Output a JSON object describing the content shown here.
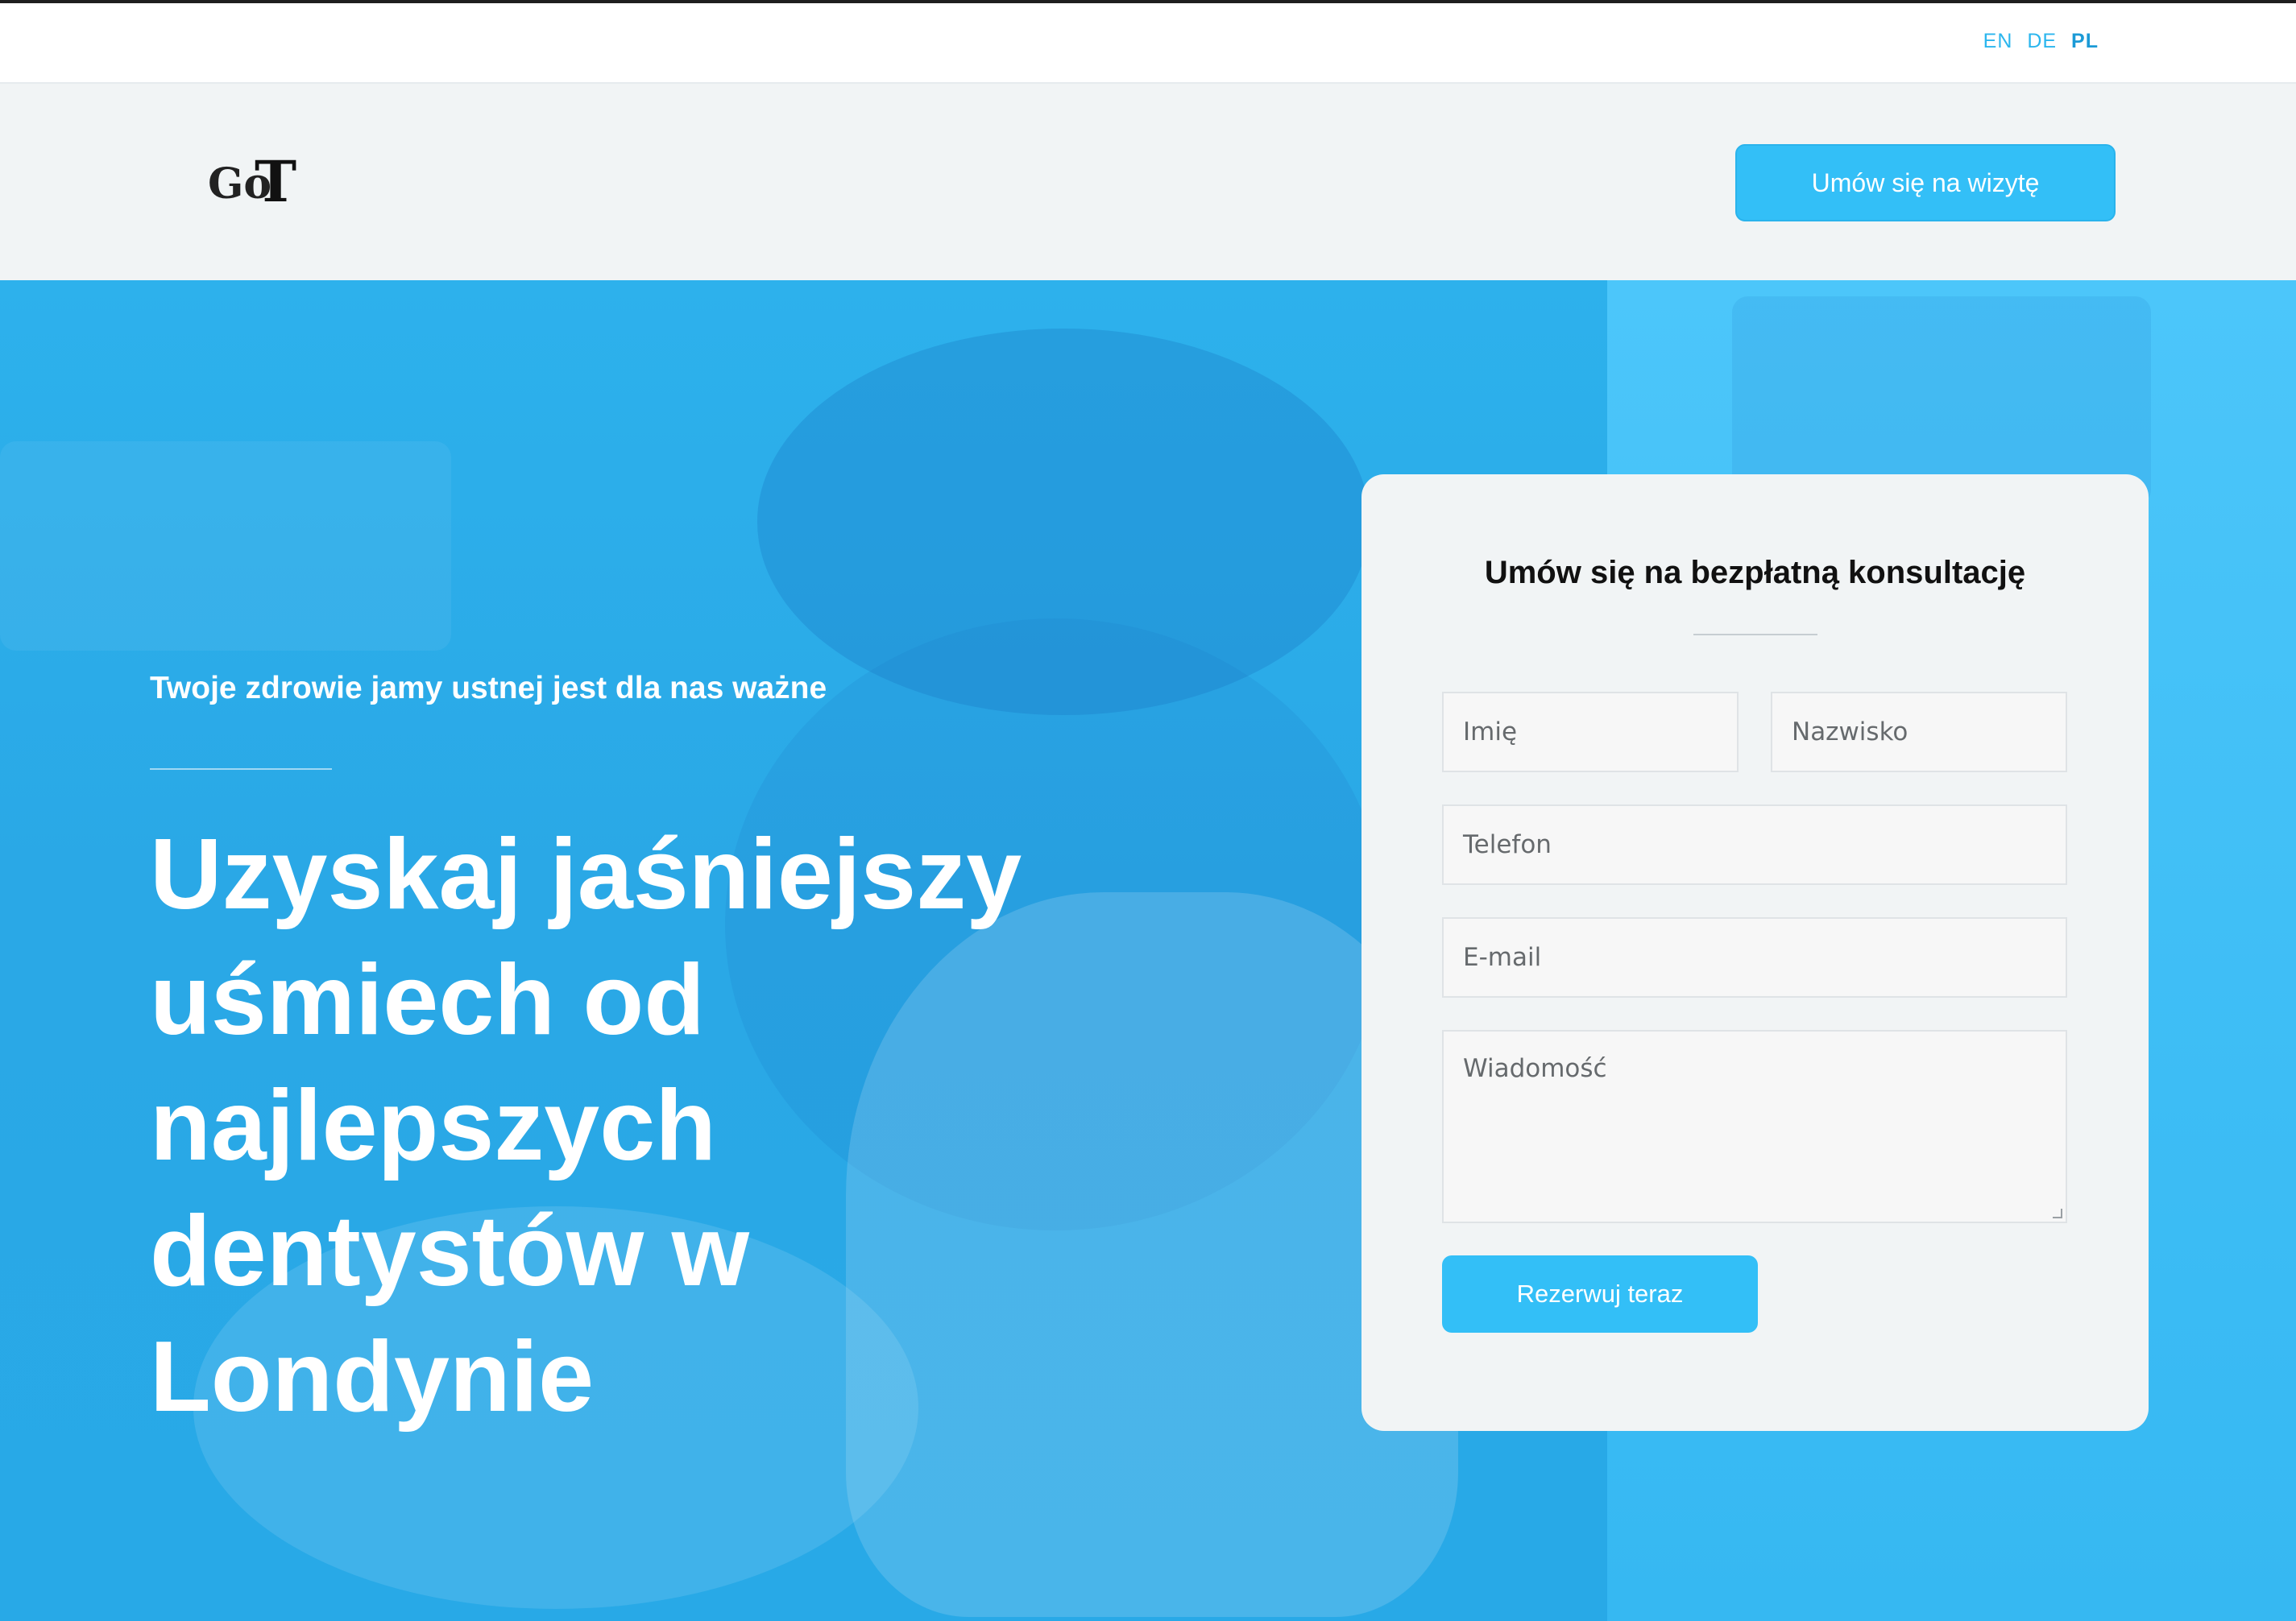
{
  "language_switcher": {
    "options": [
      "EN",
      "DE",
      "PL"
    ],
    "active": "PL"
  },
  "header": {
    "logo_text": "GoT",
    "nav_items": [
      "",
      "",
      "",
      ""
    ],
    "cta_label": "Umów się na wizytę"
  },
  "hero": {
    "kicker": "Twoje zdrowie jamy ustnej jest dla nas ważne",
    "title": "Uzyskaj jaśniejszy uśmiech od najlepszych dentystów w Londynie"
  },
  "form": {
    "title": "Umów się na bezpłatną konsultację",
    "first_name_placeholder": "Imię",
    "last_name_placeholder": "Nazwisko",
    "phone_placeholder": "Telefon",
    "email_placeholder": "E-mail",
    "message_placeholder": "Wiadomość",
    "submit_label": "Rezerwuj teraz"
  },
  "colors": {
    "accent": "#33bff7",
    "hero_background": "#2fb4ef",
    "header_background": "#f1f4f5"
  }
}
